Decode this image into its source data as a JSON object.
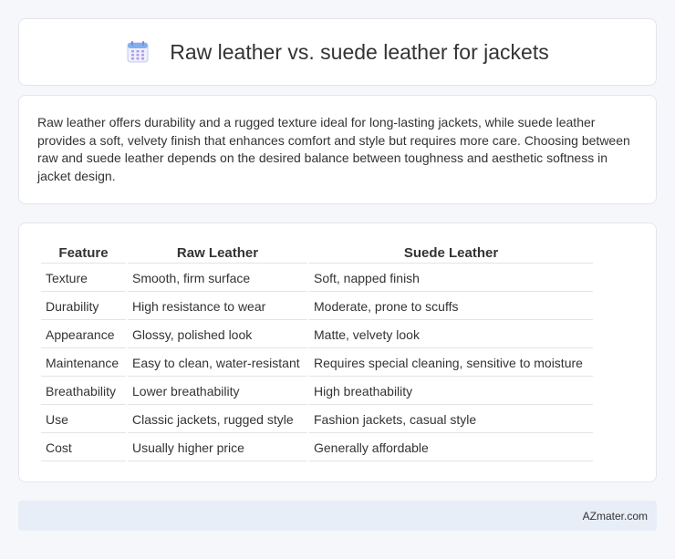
{
  "header": {
    "icon": "calendar-icon",
    "title": "Raw leather vs. suede leather for jackets"
  },
  "summary": {
    "text": "Raw leather offers durability and a rugged texture ideal for long-lasting jackets, while suede leather provides a soft, velvety finish that enhances comfort and style but requires more care. Choosing between raw and suede leather depends on the desired balance between toughness and aesthetic softness in jacket design."
  },
  "table": {
    "headers": [
      "Feature",
      "Raw Leather",
      "Suede Leather"
    ],
    "rows": [
      [
        "Texture",
        "Smooth, firm surface",
        "Soft, napped finish"
      ],
      [
        "Durability",
        "High resistance to wear",
        "Moderate, prone to scuffs"
      ],
      [
        "Appearance",
        "Glossy, polished look",
        "Matte, velvety look"
      ],
      [
        "Maintenance",
        "Easy to clean, water-resistant",
        "Requires special cleaning, sensitive to moisture"
      ],
      [
        "Breathability",
        "Lower breathability",
        "High breathability"
      ],
      [
        "Use",
        "Classic jackets, rugged style",
        "Fashion jackets, casual style"
      ],
      [
        "Cost",
        "Usually higher price",
        "Generally affordable"
      ]
    ]
  },
  "footer": {
    "text": "AZmater.com"
  },
  "colors": {
    "background": "#f5f7fa",
    "card": "#ffffff",
    "footer": "#e8eef7",
    "icon_accent": "#8b7fe0"
  }
}
